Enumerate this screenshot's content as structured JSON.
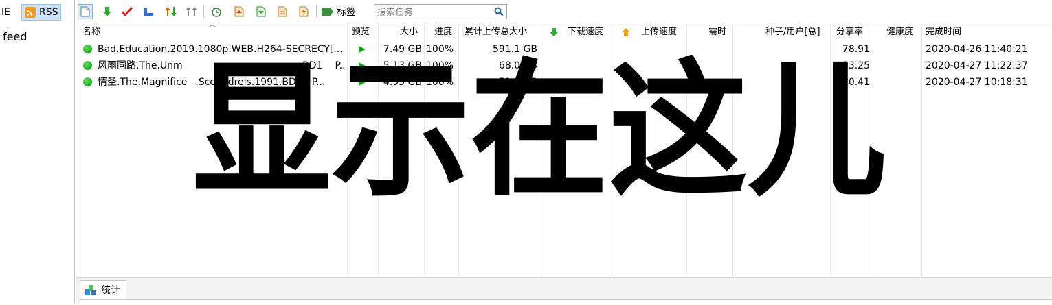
{
  "left_panel": {
    "tabs": [
      {
        "label": "IE"
      },
      {
        "label": "RSS"
      }
    ],
    "feed_label": "feed"
  },
  "toolbar": {
    "icons": [
      "new-icon",
      "download-icon",
      "check-icon",
      "chart-icon",
      "sort-icon",
      "move-icon",
      "clock-icon",
      "export-icon",
      "import-icon",
      "document-icon",
      "lightning-icon"
    ],
    "tags_label": "标签",
    "search_placeholder": "搜索任务"
  },
  "table": {
    "columns": [
      "名称",
      "预览",
      "大小",
      "进度",
      "累计上传总大小",
      "下载速度",
      "上传速度",
      "需时",
      "种子/用户[总]",
      "分享率",
      "健康度",
      "完成时间"
    ],
    "rows": [
      {
        "name": "Bad.Education.2019.1080p.WEB.H264-SECRECY[...",
        "size": "7.49 GB",
        "progress": "100%",
        "uploaded": "591.1 GB",
        "ratio": "78.91",
        "completed": "2020-04-26 11:40:21"
      },
      {
        "name": "风雨同路.The.Unm",
        "name_tail": ".BD1",
        "name_end": "P...",
        "size": "5.13 GB",
        "progress": "100%",
        "uploaded": "68.0 GB",
        "ratio": "13.25",
        "completed": "2020-04-27 11:22:37"
      },
      {
        "name": "情圣.The.Magnifice",
        "name_tail": ".Scoundrels.1991.BD1",
        "name_end": "P...",
        "size": "4.93 GB",
        "progress": "100%",
        "uploaded": "51.3 GB",
        "ratio": "10.41",
        "completed": "2020-04-27 10:18:31"
      }
    ]
  },
  "bottom": {
    "stats_tab_label": "统计"
  },
  "overlay": {
    "text": "显示在这儿"
  },
  "colors": {
    "status_green": "#18b018",
    "selected_tab_bg": "#cfe3f8",
    "rss_orange": "#f39a1d"
  }
}
